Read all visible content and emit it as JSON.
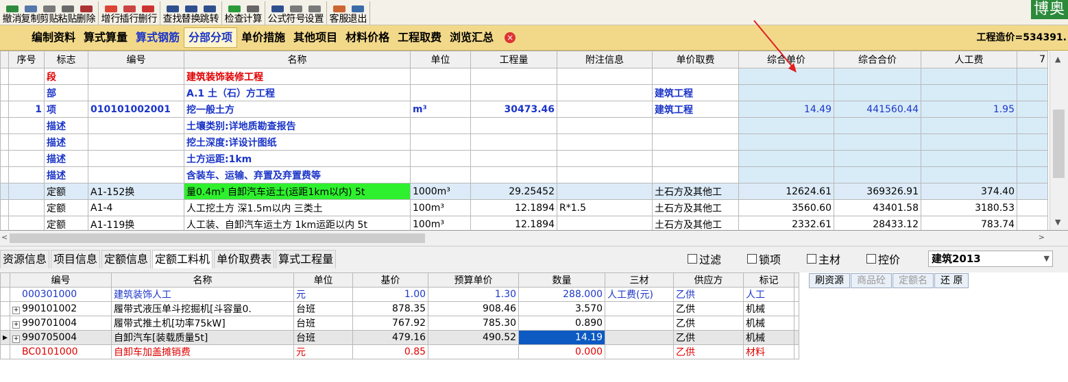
{
  "toolbar": {
    "groups": [
      [
        "撤消",
        "复制",
        "剪贴",
        "粘贴",
        "删除"
      ],
      [
        "增行",
        "插行",
        "删行"
      ],
      [
        "查找",
        "替换",
        "跳转"
      ],
      [
        "检查",
        "计算"
      ],
      [
        "公式",
        "符号",
        "设置"
      ],
      [
        "客服",
        "退出"
      ]
    ],
    "brand": "博奥"
  },
  "menu": {
    "items": [
      "编制资料",
      "算式算量",
      "算式钢筋",
      "分部分项",
      "单价措施",
      "其他项目",
      "材料价格",
      "工程取费",
      "浏览汇总"
    ],
    "active": "分部分项",
    "cost": "工程造价=534391."
  },
  "grid1": {
    "headers": [
      "序号",
      "标志",
      "编号",
      "名称",
      "单位",
      "工程量",
      "附注信息",
      "单价取费",
      "综合单价",
      "综合合价",
      "人工费",
      "7"
    ],
    "rows": [
      [
        "",
        "段",
        "",
        "建筑装饰装修工程",
        "",
        "",
        "",
        "",
        "",
        "",
        "",
        ""
      ],
      [
        "",
        "部",
        "",
        "A.1 土（石）方工程",
        "",
        "",
        "",
        "建筑工程",
        "",
        "",
        "",
        ""
      ],
      [
        "1",
        "项",
        "010101002001",
        "挖一般土方",
        "m³",
        "30473.46",
        "",
        "建筑工程",
        "14.49",
        "441560.44",
        "1.95",
        ""
      ],
      [
        "",
        "描述",
        "",
        "土壤类别:详地质勘查报告",
        "",
        "",
        "",
        "",
        "",
        "",
        "",
        ""
      ],
      [
        "",
        "描述",
        "",
        "挖土深度:详设计图纸",
        "",
        "",
        "",
        "",
        "",
        "",
        "",
        ""
      ],
      [
        "",
        "描述",
        "",
        "土方运距:1km",
        "",
        "",
        "",
        "",
        "",
        "",
        "",
        ""
      ],
      [
        "",
        "描述",
        "",
        "含装车、运输、弃置及弃置费等",
        "",
        "",
        "",
        "",
        "",
        "",
        "",
        ""
      ],
      [
        "",
        "定额",
        "A1-152换",
        "量0.4m³ 自卸汽车运土(运距1km以内) 5t",
        "1000m³",
        "29.25452",
        "",
        "土石方及其他工",
        "12624.61",
        "369326.91",
        "374.40",
        ""
      ],
      [
        "",
        "定额",
        "A1-4",
        "人工挖土方 深1.5m以内 三类土",
        "100m³",
        "12.1894",
        "R*1.5",
        "土石方及其他工",
        "3560.60",
        "43401.58",
        "3180.53",
        ""
      ],
      [
        "",
        "定额",
        "A1-119换",
        "人工装、自卸汽车运土方 1km运距以内 5t",
        "100m³",
        "12.1894",
        "",
        "土石方及其他工",
        "2332.61",
        "28433.12",
        "783.74",
        ""
      ]
    ]
  },
  "tabs": {
    "items": [
      "资源信息",
      "项目信息",
      "定额信息",
      "定额工料机",
      "单价取费表",
      "算式工程量"
    ],
    "active": "定额工料机",
    "checks": [
      "过滤",
      "锁项",
      "主材",
      "控价"
    ],
    "select": "建筑2013"
  },
  "grid2": {
    "headers": [
      "编号",
      "名称",
      "单位",
      "基价",
      "预算单价",
      "数量",
      "三材",
      "供应方",
      "标记"
    ],
    "buttons": [
      "刷资源",
      "商品砼",
      "定额名",
      "还 原"
    ],
    "rows": [
      [
        "000301000",
        "建筑装饰人工",
        "元",
        "1.00",
        "1.30",
        "288.000",
        "人工费(元)",
        "乙供",
        "人工"
      ],
      [
        "990101002",
        "履带式液压单斗挖掘机[斗容量0.",
        "台班",
        "878.35",
        "908.46",
        "3.570",
        "",
        "乙供",
        "机械"
      ],
      [
        "990701004",
        "履带式推土机[功率75kW]",
        "台班",
        "767.92",
        "785.30",
        "0.890",
        "",
        "乙供",
        "机械"
      ],
      [
        "990705004",
        "自卸汽车[装载质量5t]",
        "台班",
        "479.16",
        "490.52",
        "14.19",
        "",
        "乙供",
        "机械"
      ],
      [
        "BC0101000",
        "自卸车加盖摊销费",
        "元",
        "0.85",
        "",
        "0.000",
        "",
        "乙供",
        "材料"
      ]
    ]
  },
  "colors": {
    "menu_bg": "#f2d98a",
    "brand": "#2c8a3a",
    "highlight_green": "#2ef02e",
    "select_blue": "#0c5ac2"
  }
}
